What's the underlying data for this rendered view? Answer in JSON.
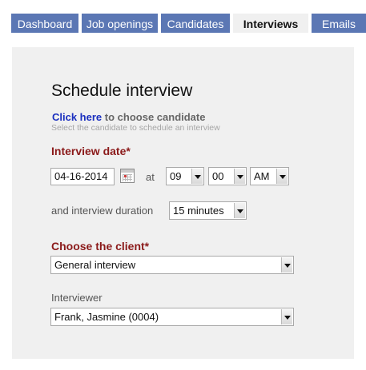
{
  "tabs": [
    {
      "label": "Dashboard",
      "active": false
    },
    {
      "label": "Job openings",
      "active": false
    },
    {
      "label": "Candidates",
      "active": false
    },
    {
      "label": "Interviews",
      "active": true
    },
    {
      "label": "Emails",
      "active": false
    }
  ],
  "form": {
    "title": "Schedule interview",
    "choose_candidate_link": "Click here",
    "choose_candidate_rest": "to choose candidate",
    "choose_candidate_hint": "Select the candidate to schedule an interview",
    "interview_date_label": "Interview date*",
    "date_value": "04-16-2014",
    "at_label": "at",
    "hour_value": "09",
    "minute_value": "00",
    "ampm_value": "AM",
    "duration_label": "and interview duration",
    "duration_value": "15 minutes",
    "client_label": "Choose the client*",
    "client_value": "General interview",
    "interviewer_label": "Interviewer",
    "interviewer_value": "Frank, Jasmine (0004)"
  },
  "colors": {
    "tab": "#5b77b4",
    "active_tab": "#f0f0f0",
    "required_label": "#8b1a1a",
    "link": "#1a2fbf",
    "panel": "#f0f0f0"
  }
}
